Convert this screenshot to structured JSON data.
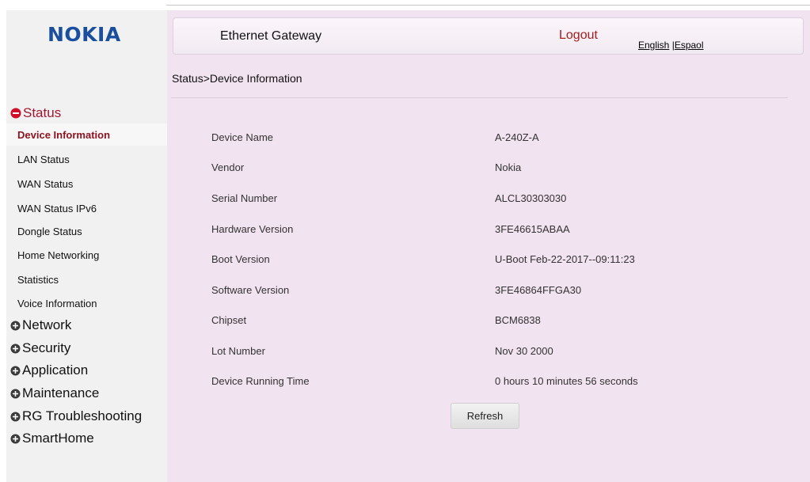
{
  "brand": "NOKIA",
  "header": {
    "title": "Ethernet Gateway",
    "logout": "Logout",
    "lang_english": "English",
    "lang_sep": " |",
    "lang_spanish": "Espaol"
  },
  "breadcrumb": "Status>Device Information",
  "sidebar": {
    "status": {
      "label": "Status",
      "items": [
        "Device Information",
        "LAN Status",
        "WAN Status",
        "WAN Status IPv6",
        "Dongle Status",
        "Home Networking",
        "Statistics",
        "Voice Information"
      ]
    },
    "sections": [
      "Network",
      "Security",
      "Application",
      "Maintenance",
      "RG Troubleshooting",
      "SmartHome"
    ]
  },
  "device_info": [
    {
      "label": "Device Name",
      "value": "A-240Z-A"
    },
    {
      "label": "Vendor",
      "value": "Nokia"
    },
    {
      "label": "Serial Number",
      "value": "ALCL30303030"
    },
    {
      "label": "Hardware Version",
      "value": "3FE46615ABAA"
    },
    {
      "label": "Boot Version",
      "value": "U-Boot Feb-22-2017--09:11:23"
    },
    {
      "label": "Software Version",
      "value": "3FE46864FFGA30"
    },
    {
      "label": "Chipset",
      "value": "BCM6838"
    },
    {
      "label": "Lot Number",
      "value": "Nov 30 2000"
    },
    {
      "label": "Device Running Time",
      "value": "0 hours 10 minutes 56 seconds"
    }
  ],
  "refresh_label": "Refresh",
  "colors": {
    "brand": "#1a4fa0",
    "active_item": "#8b1420",
    "content_bg": "#f2e3f1",
    "logout": "#a51c1c"
  },
  "icons": {
    "expanded": "minus-circle-icon",
    "collapsed": "plus-circle-icon"
  }
}
